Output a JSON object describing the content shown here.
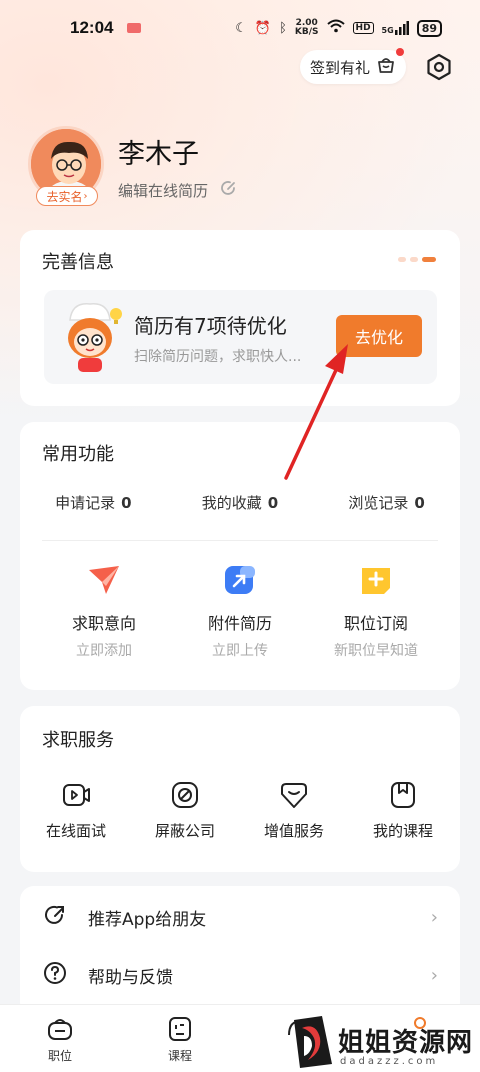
{
  "status_bar": {
    "time": "12:04",
    "net_speed_value": "2.00",
    "net_speed_unit": "KB/S",
    "hd": "HD",
    "signal": "5G",
    "battery": "89"
  },
  "header": {
    "sign_in_label": "签到有礼"
  },
  "profile": {
    "name": "李木子",
    "edit_resume": "编辑在线简历",
    "realname_badge": "去实名"
  },
  "improve_card": {
    "title": "完善信息",
    "headline": "简历有7项待优化",
    "subtitle": "扫除简历问题，求职快人...",
    "button": "去优化"
  },
  "common_functions": {
    "title": "常用功能",
    "stats": [
      {
        "label": "申请记录",
        "count": "0"
      },
      {
        "label": "我的收藏",
        "count": "0"
      },
      {
        "label": "浏览记录",
        "count": "0"
      }
    ],
    "items": [
      {
        "title": "求职意向",
        "sub": "立即添加",
        "icon": "paper-plane-icon"
      },
      {
        "title": "附件简历",
        "sub": "立即上传",
        "icon": "upload-folder-icon"
      },
      {
        "title": "职位订阅",
        "sub": "新职位早知道",
        "icon": "subscribe-plus-icon"
      }
    ]
  },
  "job_services": {
    "title": "求职服务",
    "items": [
      {
        "label": "在线面试",
        "icon": "video-icon"
      },
      {
        "label": "屏蔽公司",
        "icon": "block-icon"
      },
      {
        "label": "增值服务",
        "icon": "value-service-icon"
      },
      {
        "label": "我的课程",
        "icon": "course-icon"
      }
    ]
  },
  "menu": {
    "items": [
      {
        "label": "推荐App给朋友",
        "icon": "share-icon"
      },
      {
        "label": "帮助与反馈",
        "icon": "help-icon"
      }
    ]
  },
  "tabbar": {
    "items": [
      {
        "label": "职位",
        "icon": "jobs-icon"
      },
      {
        "label": "课程",
        "icon": "course-tab-icon"
      }
    ]
  },
  "watermark": {
    "text": "姐姐资源网",
    "sub": "dadazzz.com"
  },
  "colors": {
    "accent": "#f07b2c",
    "arrow": "#e02424"
  }
}
